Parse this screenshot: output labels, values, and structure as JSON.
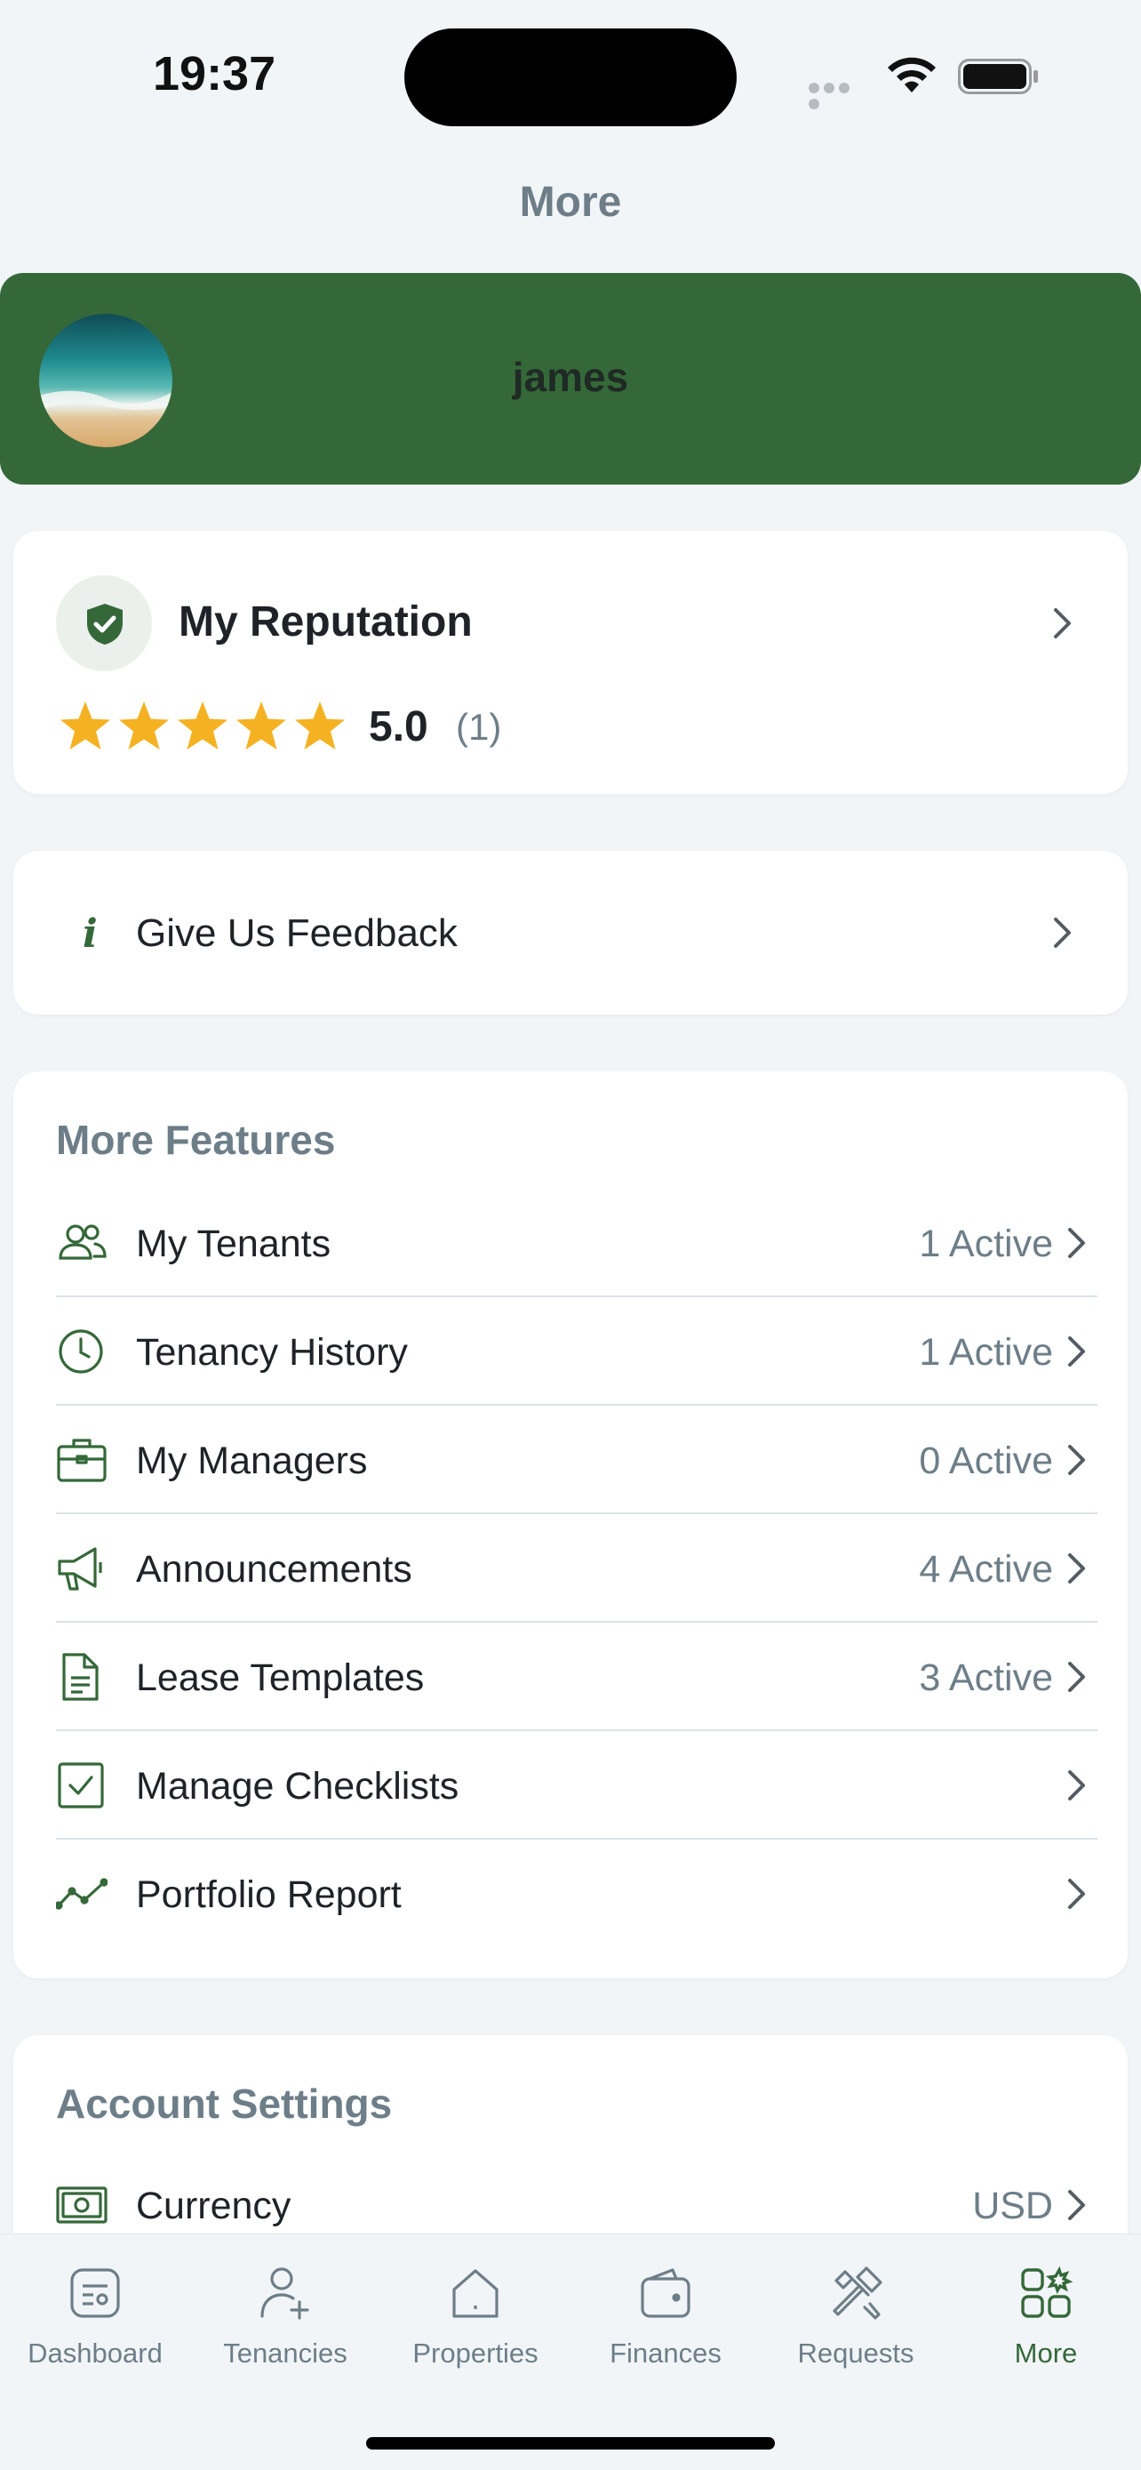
{
  "status_bar": {
    "time": "19:37"
  },
  "header": {
    "title": "More"
  },
  "profile": {
    "name": "james"
  },
  "reputation": {
    "title": "My Reputation",
    "score": "5.0",
    "count": "(1)",
    "stars": 5
  },
  "feedback": {
    "label": "Give Us Feedback"
  },
  "more_features": {
    "title": "More Features",
    "items": [
      {
        "label": "My Tenants",
        "value": "1 Active",
        "icon": "people-icon"
      },
      {
        "label": "Tenancy History",
        "value": "1 Active",
        "icon": "clock-icon"
      },
      {
        "label": "My Managers",
        "value": "0 Active",
        "icon": "briefcase-icon"
      },
      {
        "label": "Announcements",
        "value": "4 Active",
        "icon": "megaphone-icon"
      },
      {
        "label": "Lease Templates",
        "value": "3 Active",
        "icon": "document-icon"
      },
      {
        "label": "Manage Checklists",
        "value": "",
        "icon": "checkbox-icon"
      },
      {
        "label": "Portfolio Report",
        "value": "",
        "icon": "trend-line-icon"
      }
    ]
  },
  "account_settings": {
    "title": "Account Settings",
    "items": [
      {
        "label": "Currency",
        "value": "USD",
        "icon": "money-icon"
      }
    ]
  },
  "tab_bar": {
    "tabs": [
      {
        "label": "Dashboard",
        "icon": "dashboard-icon"
      },
      {
        "label": "Tenancies",
        "icon": "add-person-icon"
      },
      {
        "label": "Properties",
        "icon": "house-icon"
      },
      {
        "label": "Finances",
        "icon": "wallet-icon"
      },
      {
        "label": "Requests",
        "icon": "tools-icon"
      },
      {
        "label": "More",
        "icon": "grid-icon",
        "active": true
      }
    ]
  },
  "colors": {
    "brand_green": "#356839",
    "muted_text": "#6d7e88",
    "star": "#f4b223",
    "background": "#f2f5f8"
  }
}
